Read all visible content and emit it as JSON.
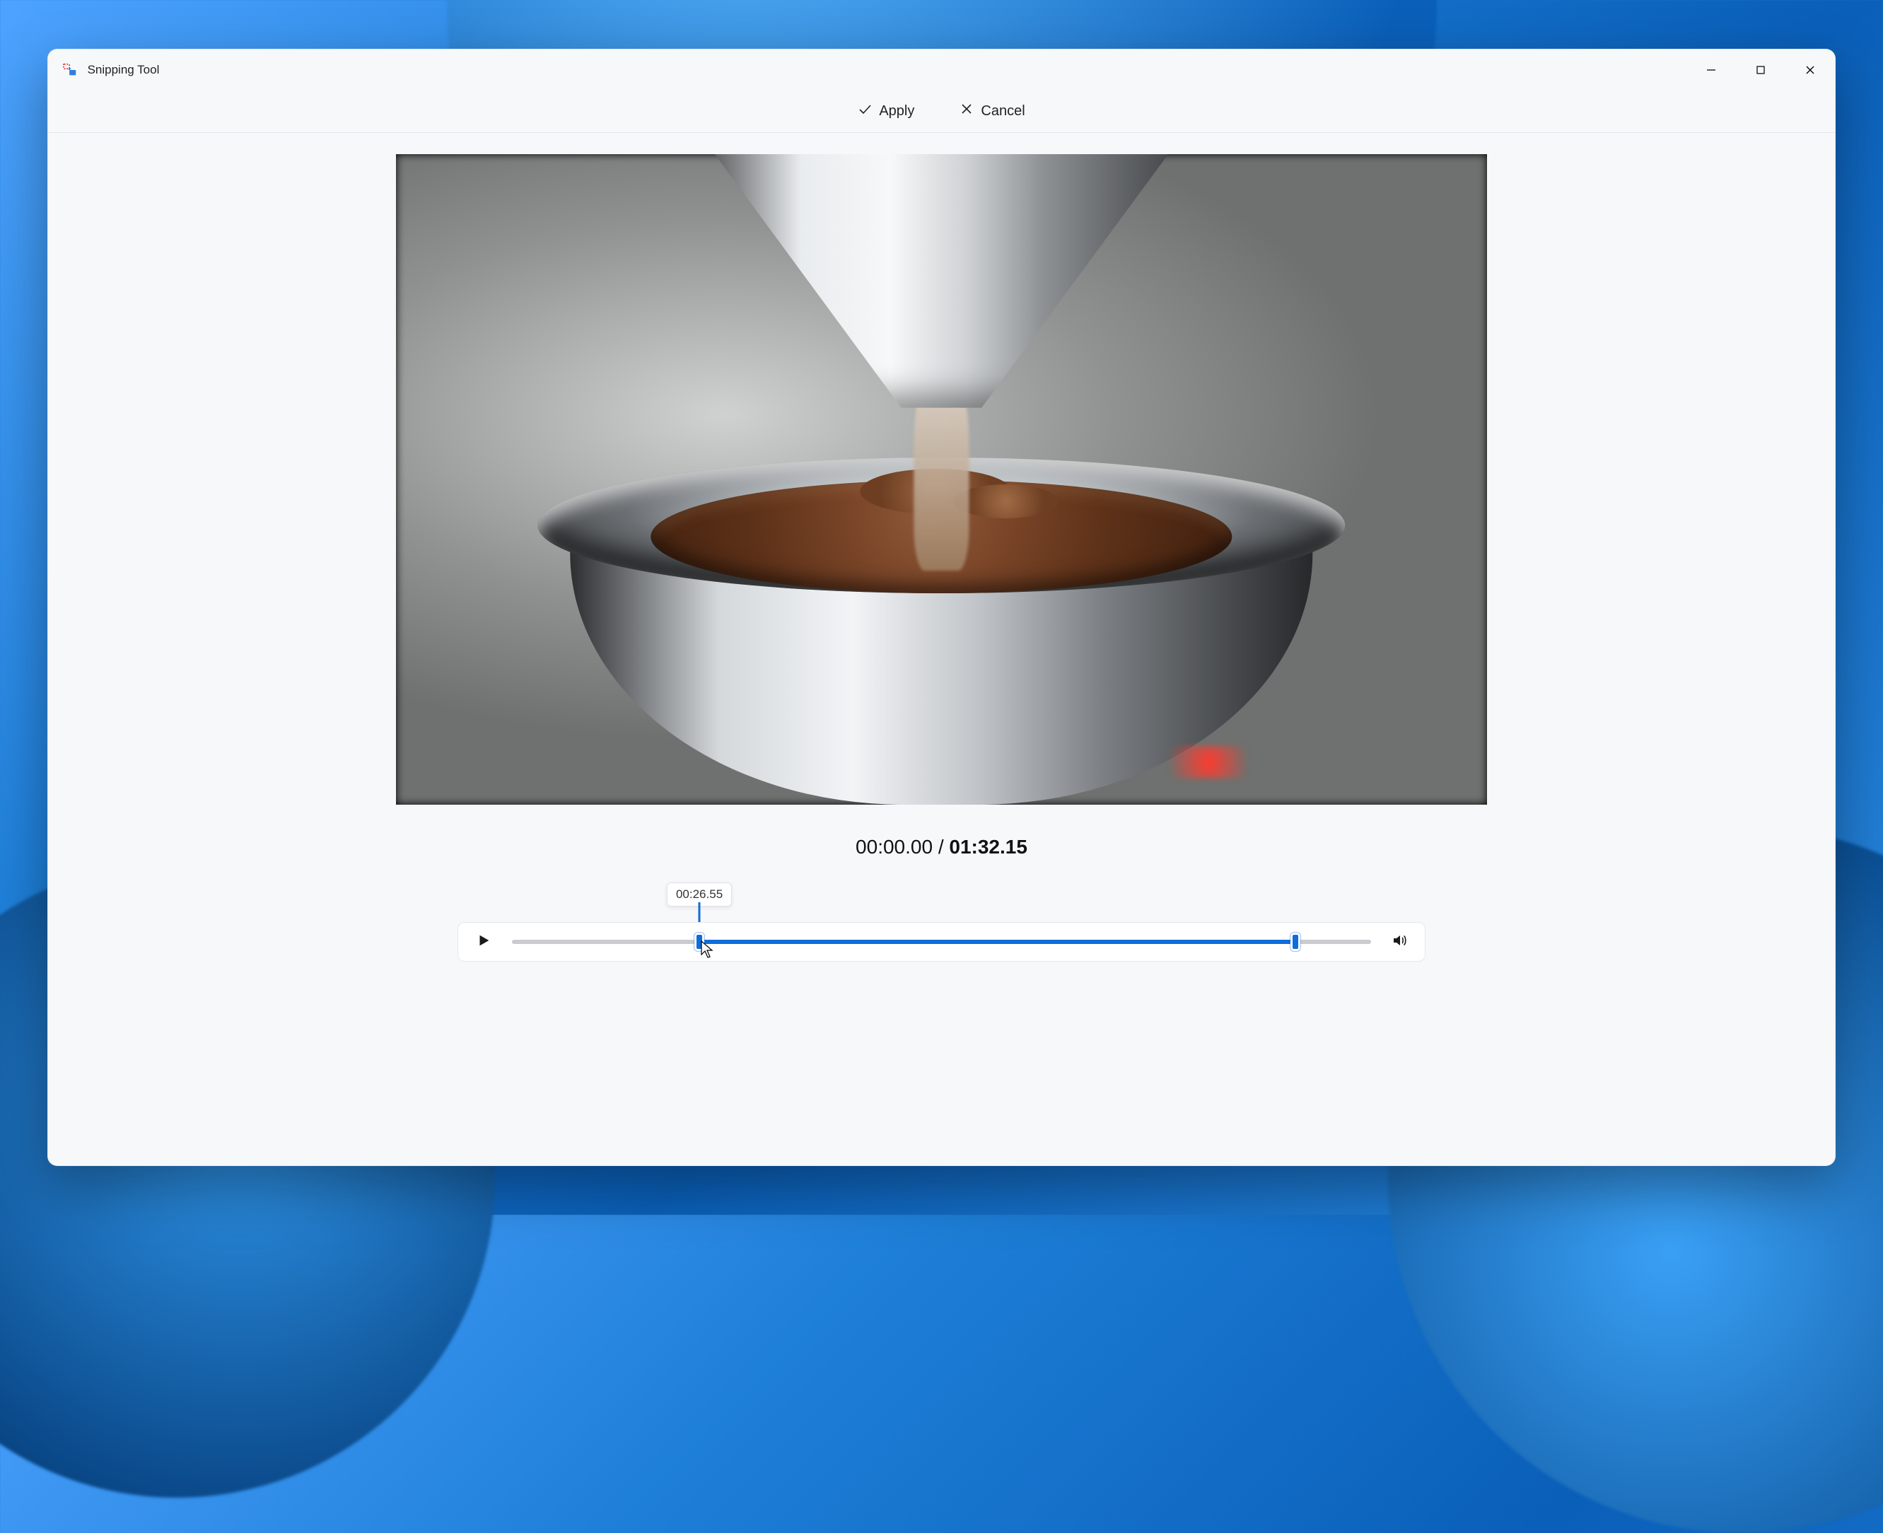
{
  "window": {
    "title": "Snipping Tool"
  },
  "toolbar": {
    "apply_label": "Apply",
    "cancel_label": "Cancel"
  },
  "time": {
    "current": "00:00.00",
    "separator": " / ",
    "total": "01:32.15"
  },
  "trim": {
    "tooltip_time": "00:26.55",
    "start_percent": 21.8,
    "end_percent": 91.2
  },
  "colors": {
    "accent": "#0f6cda"
  }
}
